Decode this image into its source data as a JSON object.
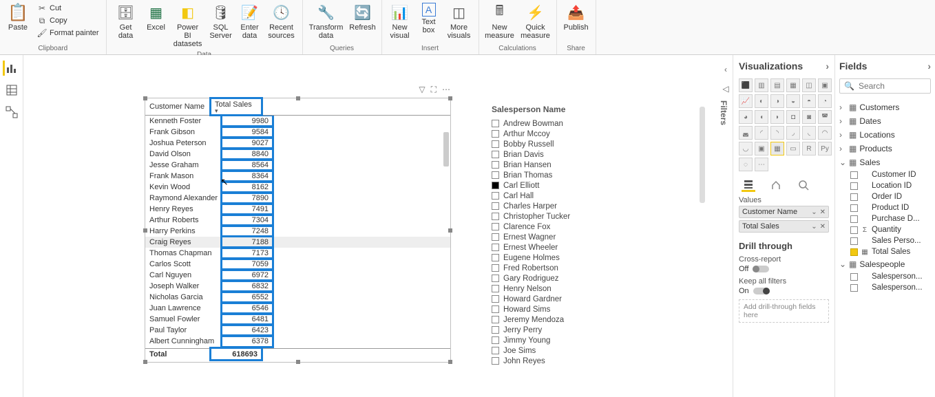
{
  "ribbon": {
    "groups": {
      "clipboard": {
        "label": "Clipboard",
        "paste": "Paste",
        "cut": "Cut",
        "copy": "Copy",
        "format_painter": "Format painter"
      },
      "data": {
        "label": "Data",
        "get_data": "Get data",
        "excel": "Excel",
        "powerbi_ds": "Power BI datasets",
        "sql": "SQL Server",
        "enter": "Enter data",
        "recent": "Recent sources"
      },
      "queries": {
        "label": "Queries",
        "transform": "Transform data",
        "refresh": "Refresh"
      },
      "insert": {
        "label": "Insert",
        "new_visual": "New visual",
        "text_box": "Text box",
        "more_visuals": "More visuals"
      },
      "calculations": {
        "label": "Calculations",
        "new_measure": "New measure",
        "quick_measure": "Quick measure"
      },
      "share": {
        "label": "Share",
        "publish": "Publish"
      }
    }
  },
  "table_visual": {
    "columns": [
      "Customer Name",
      "Total Sales"
    ],
    "rows": [
      {
        "name": "Kenneth Foster",
        "total": 9980
      },
      {
        "name": "Frank Gibson",
        "total": 9584
      },
      {
        "name": "Joshua Peterson",
        "total": 9027
      },
      {
        "name": "David Olson",
        "total": 8840
      },
      {
        "name": "Jesse Graham",
        "total": 8564
      },
      {
        "name": "Frank Mason",
        "total": 8364
      },
      {
        "name": "Kevin Wood",
        "total": 8162
      },
      {
        "name": "Raymond Alexander",
        "total": 7890
      },
      {
        "name": "Henry Reyes",
        "total": 7491
      },
      {
        "name": "Arthur Roberts",
        "total": 7304
      },
      {
        "name": "Harry Perkins",
        "total": 7248
      },
      {
        "name": "Craig Reyes",
        "total": 7188
      },
      {
        "name": "Thomas Chapman",
        "total": 7173
      },
      {
        "name": "Carlos Scott",
        "total": 7059
      },
      {
        "name": "Carl Nguyen",
        "total": 6972
      },
      {
        "name": "Joseph Walker",
        "total": 6832
      },
      {
        "name": "Nicholas Garcia",
        "total": 6552
      },
      {
        "name": "Juan Lawrence",
        "total": 6546
      },
      {
        "name": "Samuel Fowler",
        "total": 6481
      },
      {
        "name": "Paul Taylor",
        "total": 6423
      },
      {
        "name": "Albert Cunningham",
        "total": 6378
      }
    ],
    "total_label": "Total",
    "total_value": 618693,
    "highlight_row_index": 11
  },
  "slicer": {
    "title": "Salesperson Name",
    "items": [
      {
        "label": "Andrew Bowman",
        "checked": false
      },
      {
        "label": "Arthur Mccoy",
        "checked": false
      },
      {
        "label": "Bobby Russell",
        "checked": false
      },
      {
        "label": "Brian Davis",
        "checked": false
      },
      {
        "label": "Brian Hansen",
        "checked": false
      },
      {
        "label": "Brian Thomas",
        "checked": false
      },
      {
        "label": "Carl Elliott",
        "checked": true
      },
      {
        "label": "Carl Hall",
        "checked": false
      },
      {
        "label": "Charles Harper",
        "checked": false
      },
      {
        "label": "Christopher Tucker",
        "checked": false
      },
      {
        "label": "Clarence Fox",
        "checked": false
      },
      {
        "label": "Ernest Wagner",
        "checked": false
      },
      {
        "label": "Ernest Wheeler",
        "checked": false
      },
      {
        "label": "Eugene Holmes",
        "checked": false
      },
      {
        "label": "Fred Robertson",
        "checked": false
      },
      {
        "label": "Gary Rodriguez",
        "checked": false
      },
      {
        "label": "Henry Nelson",
        "checked": false
      },
      {
        "label": "Howard Gardner",
        "checked": false
      },
      {
        "label": "Howard Sims",
        "checked": false
      },
      {
        "label": "Jeremy Mendoza",
        "checked": false
      },
      {
        "label": "Jerry Perry",
        "checked": false
      },
      {
        "label": "Jimmy Young",
        "checked": false
      },
      {
        "label": "Joe Sims",
        "checked": false
      },
      {
        "label": "John Reyes",
        "checked": false
      }
    ]
  },
  "filters_tab": "Filters",
  "viz_pane": {
    "title": "Visualizations",
    "values_label": "Values",
    "pills": [
      "Customer Name",
      "Total Sales"
    ],
    "drill_title": "Drill through",
    "cross_report": "Cross-report",
    "off": "Off",
    "keep_filters": "Keep all filters",
    "on": "On",
    "drill_well": "Add drill-through fields here"
  },
  "fields_pane": {
    "title": "Fields",
    "search_placeholder": "Search",
    "tables": [
      {
        "name": "Customers",
        "expanded": false,
        "fields": []
      },
      {
        "name": "Dates",
        "expanded": false,
        "fields": []
      },
      {
        "name": "Locations",
        "expanded": false,
        "fields": []
      },
      {
        "name": "Products",
        "expanded": false,
        "fields": []
      },
      {
        "name": "Sales",
        "expanded": true,
        "fields": [
          {
            "label": "Customer ID",
            "checked": false,
            "icon": ""
          },
          {
            "label": "Location ID",
            "checked": false,
            "icon": ""
          },
          {
            "label": "Order ID",
            "checked": false,
            "icon": ""
          },
          {
            "label": "Product ID",
            "checked": false,
            "icon": ""
          },
          {
            "label": "Purchase D...",
            "checked": false,
            "icon": ""
          },
          {
            "label": "Quantity",
            "checked": false,
            "icon": "Σ"
          },
          {
            "label": "Sales Perso...",
            "checked": false,
            "icon": ""
          },
          {
            "label": "Total Sales",
            "checked": true,
            "icon": "▦"
          }
        ]
      },
      {
        "name": "Salespeople",
        "expanded": true,
        "fields": [
          {
            "label": "Salesperson...",
            "checked": false,
            "icon": ""
          },
          {
            "label": "Salesperson...",
            "checked": false,
            "icon": ""
          }
        ]
      }
    ]
  }
}
